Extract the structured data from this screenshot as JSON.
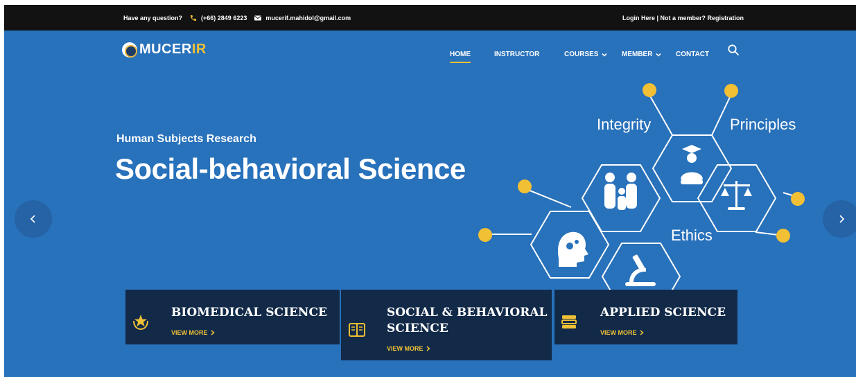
{
  "topbar": {
    "question": "Have any question?",
    "phone": "(+66) 2849 6223",
    "email": "mucerif.mahidol@gmail.com",
    "auth": "Login Here | Not a member? Registration"
  },
  "brand": {
    "logo_text_a": "MUCER",
    "logo_text_b": "IR"
  },
  "nav": {
    "home": "HOME",
    "instructor": "INSTRUCTOR",
    "courses": "COURSES",
    "member": "MEMBER",
    "contact": "CONTACT"
  },
  "hero": {
    "subtitle": "Human Subjects Research",
    "title": "Social-behavioral Science"
  },
  "illustration": {
    "label_integrity": "Integrity",
    "label_principles": "Principles",
    "label_ethics": "Ethics"
  },
  "cards": [
    {
      "title_line1": "BIOMEDICAL SCIENCE",
      "title_line2": "",
      "link": "VIEW MORE"
    },
    {
      "title_line1": "SOCIAL & BEHAVIORAL",
      "title_line2": "SCIENCE",
      "link": "VIEW MORE"
    },
    {
      "title_line1": "APPLIED SCIENCE",
      "title_line2": "",
      "link": "VIEW MORE"
    }
  ],
  "icons": {
    "phone": "phone-icon",
    "email": "envelope-icon",
    "search": "search-icon",
    "prev": "chevron-left-icon",
    "next": "chevron-right-icon",
    "card1": "award-star-icon",
    "card2": "open-book-icon",
    "card3": "book-stack-icon"
  },
  "colors": {
    "topbar": "#121212",
    "hero_bg": "#2871bb",
    "accent": "#f2c035",
    "card_bg": "#122a48"
  }
}
